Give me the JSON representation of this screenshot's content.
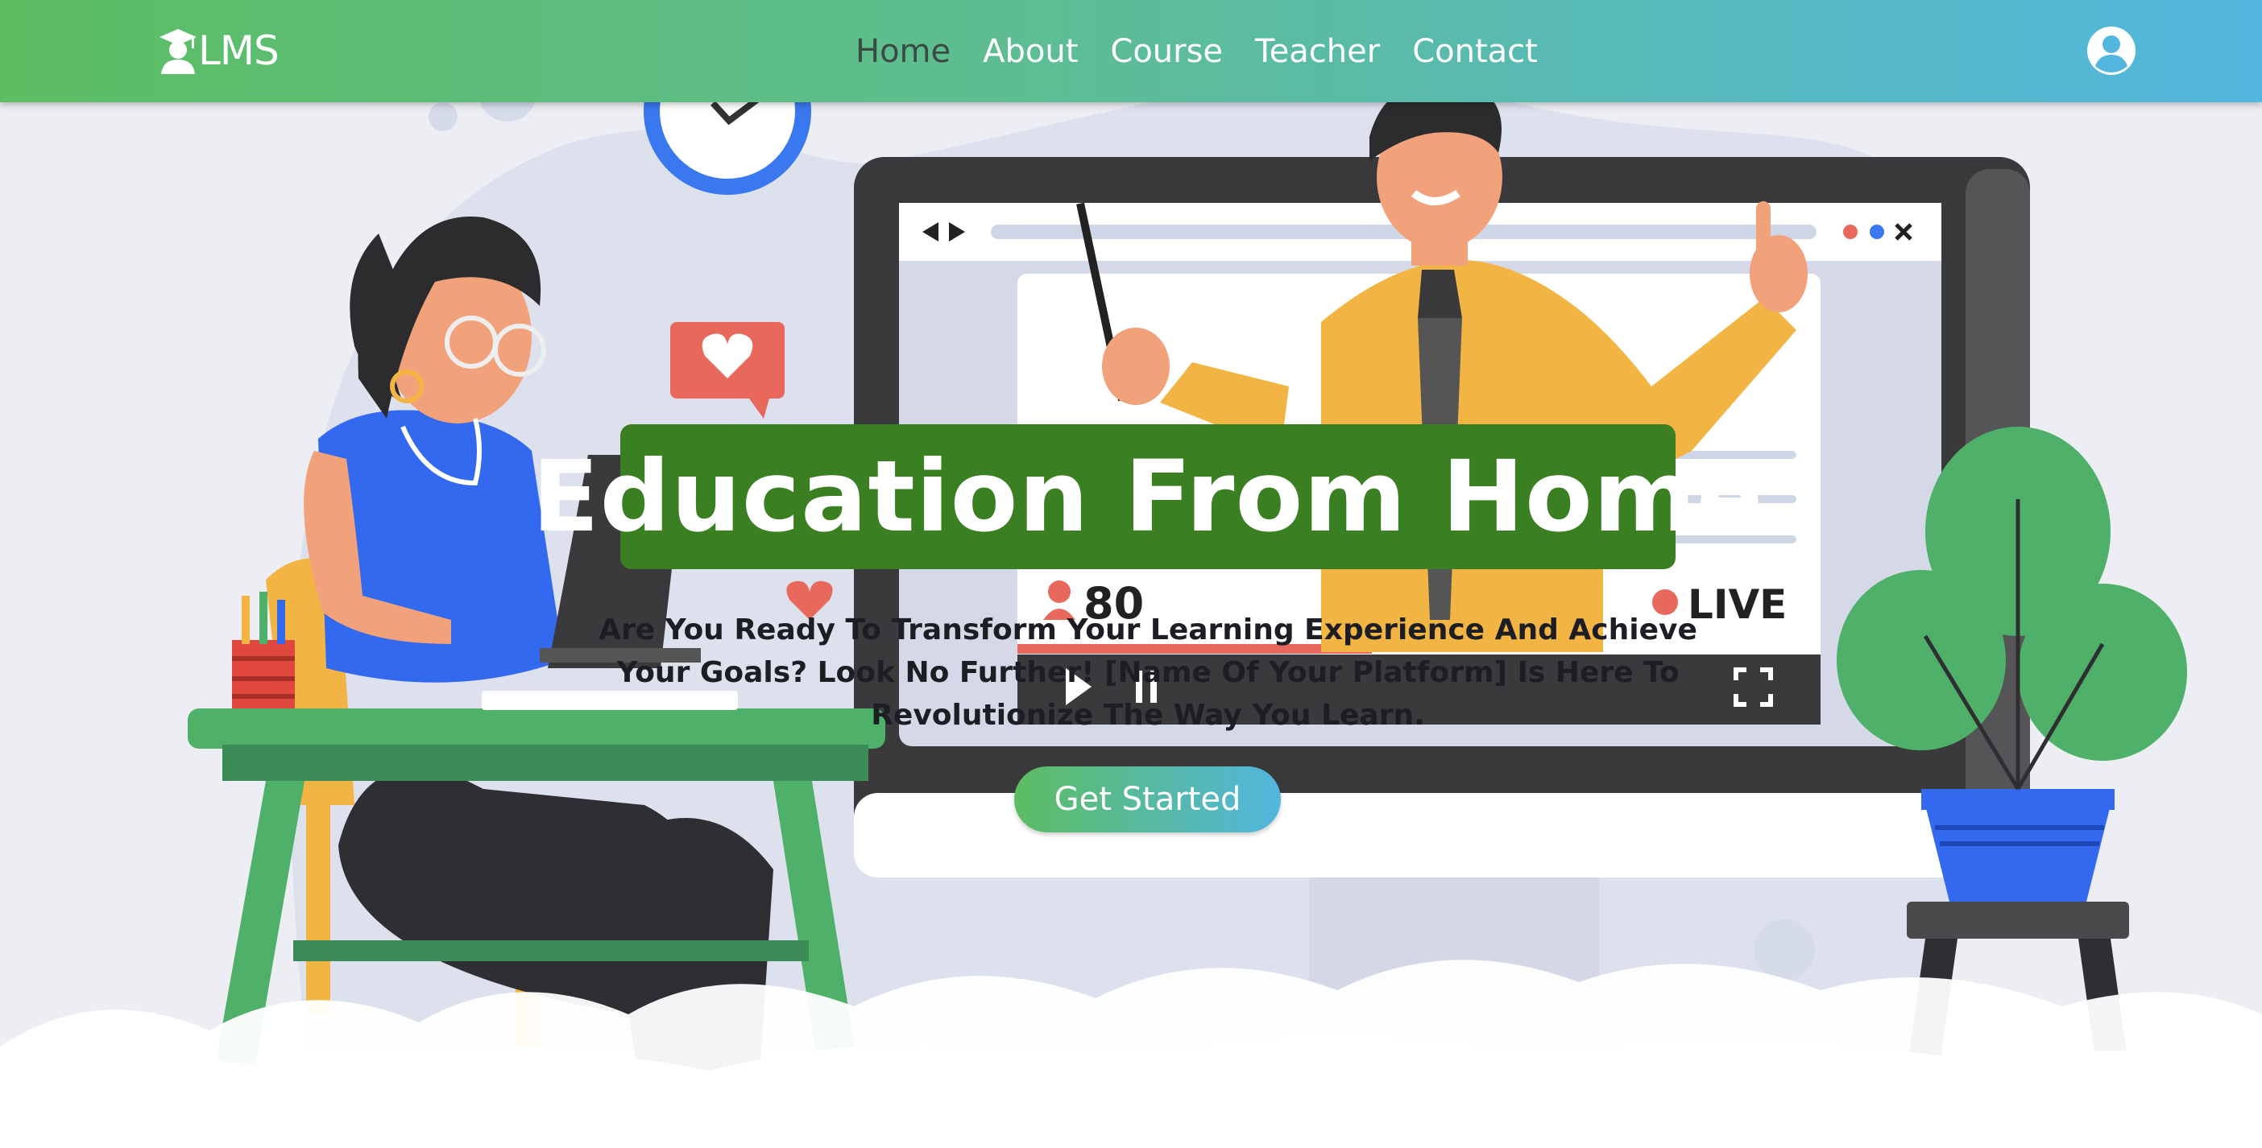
{
  "brand": {
    "logo_text": "LMS",
    "icon": "graduate-icon"
  },
  "nav": {
    "items": [
      {
        "label": "Home",
        "active": true
      },
      {
        "label": "About",
        "active": false
      },
      {
        "label": "Course",
        "active": false
      },
      {
        "label": "Teacher",
        "active": false
      },
      {
        "label": "Contact",
        "active": false
      }
    ],
    "user_icon": "user-circle-icon"
  },
  "hero": {
    "title": "Education From Home",
    "subtitle": "Are You Ready To Transform Your Learning Experience And Achieve Your Goals? Look No Further! [Name Of Your Platform] Is Here To Revolutionize The Way You Learn.",
    "cta_label": "Get Started"
  },
  "illustration": {
    "viewer_count": "80",
    "live_label": "LIVE"
  },
  "colors": {
    "nav_gradient_start": "#5cbd62",
    "nav_gradient_end": "#52b6de",
    "title_bg": "#3a8022",
    "background": "#eceef4"
  }
}
